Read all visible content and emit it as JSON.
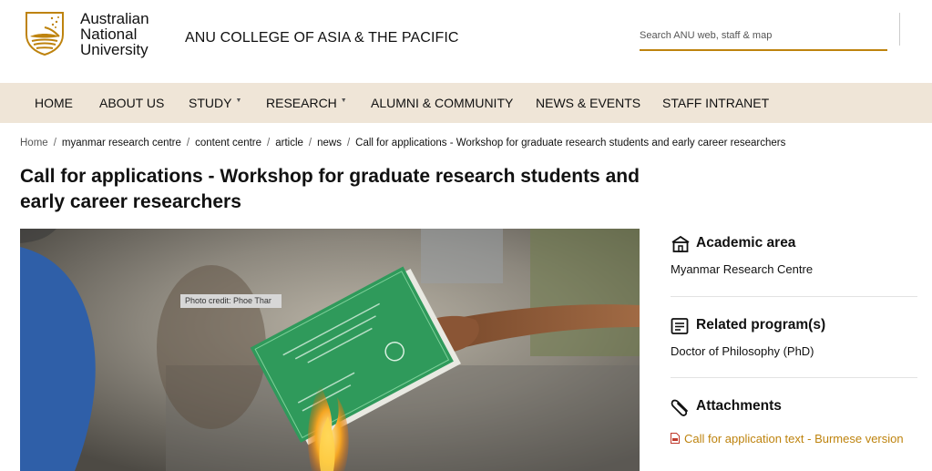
{
  "header": {
    "university_lines": [
      "Australian",
      "National",
      "University"
    ],
    "college": "ANU COLLEGE OF ASIA & THE PACIFIC",
    "search_placeholder": "Search ANU web, staff & map",
    "brand_color": "#be830e"
  },
  "nav": {
    "items": [
      {
        "label": "HOME",
        "dropdown": false
      },
      {
        "label": "ABOUT US",
        "dropdown": false
      },
      {
        "label": "STUDY",
        "dropdown": true
      },
      {
        "label": "RESEARCH",
        "dropdown": true
      },
      {
        "label": "ALUMNI & COMMUNITY",
        "dropdown": false
      },
      {
        "label": "NEWS & EVENTS",
        "dropdown": false
      },
      {
        "label": "STAFF INTRANET",
        "dropdown": false
      }
    ],
    "background": "#efe5d7"
  },
  "breadcrumb": {
    "items": [
      "Home",
      "myanmar research centre",
      "content centre",
      "article",
      "news",
      "Call for applications - Workshop for graduate research students and early career researchers"
    ],
    "separator": "/"
  },
  "article": {
    "title": "Call for applications - Workshop for graduate research students and early career researchers",
    "photo_credit": "Photo credit: Phoe Thar"
  },
  "sidebar": {
    "academic_area": {
      "heading": "Academic area",
      "value": "Myanmar Research Centre",
      "icon": "building-icon"
    },
    "related_programs": {
      "heading": "Related program(s)",
      "value": "Doctor of Philosophy (PhD)",
      "icon": "document-icon"
    },
    "attachments": {
      "heading": "Attachments",
      "icon": "paperclip-icon",
      "link": "Call for application text - Burmese version",
      "link_icon": "pdf-file-icon"
    }
  }
}
